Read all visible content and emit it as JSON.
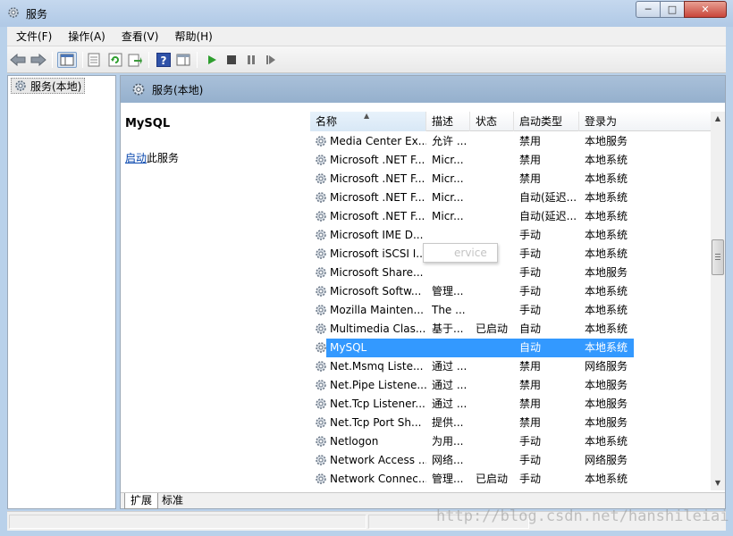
{
  "window": {
    "title": "服务",
    "min_glyph": "─",
    "max_glyph": "□",
    "close_glyph": "✕"
  },
  "menu": [
    "文件(F)",
    "操作(A)",
    "查看(V)",
    "帮助(H)"
  ],
  "toolbar": {
    "icons": [
      "back-arrow-icon",
      "forward-arrow-icon",
      "show-hide-tree-icon",
      "properties-icon",
      "refresh-icon",
      "export-list-icon",
      "help-icon",
      "show-action-pane-icon",
      "start-service-icon",
      "stop-service-icon",
      "pause-service-icon",
      "restart-service-icon"
    ]
  },
  "tree": {
    "root_label": "服务(本地)"
  },
  "pane": {
    "header_title": "服务(本地)",
    "selected_service": "MySQL",
    "action_link": "启动",
    "action_suffix": "此服务"
  },
  "columns": {
    "name": "名称",
    "description": "描述",
    "status": "状态",
    "startup": "启动类型",
    "logon": "登录为"
  },
  "services": [
    {
      "name": "Media Center Ex...",
      "desc": "允许 ...",
      "status": "",
      "startup": "禁用",
      "logon": "本地服务"
    },
    {
      "name": "Microsoft .NET F...",
      "desc": "Micr...",
      "status": "",
      "startup": "禁用",
      "logon": "本地系统"
    },
    {
      "name": "Microsoft .NET F...",
      "desc": "Micr...",
      "status": "",
      "startup": "禁用",
      "logon": "本地系统"
    },
    {
      "name": "Microsoft .NET F...",
      "desc": "Micr...",
      "status": "",
      "startup": "自动(延迟...",
      "logon": "本地系统"
    },
    {
      "name": "Microsoft .NET F...",
      "desc": "Micr...",
      "status": "",
      "startup": "自动(延迟...",
      "logon": "本地系统"
    },
    {
      "name": "Microsoft IME D...",
      "desc": "",
      "status": "",
      "startup": "手动",
      "logon": "本地系统"
    },
    {
      "name": "Microsoft iSCSI I...",
      "desc": "管理...",
      "status": "",
      "startup": "手动",
      "logon": "本地系统"
    },
    {
      "name": "Microsoft Share...",
      "desc": "",
      "status": "",
      "startup": "手动",
      "logon": "本地服务"
    },
    {
      "name": "Microsoft Softw...",
      "desc": "管理...",
      "status": "",
      "startup": "手动",
      "logon": "本地系统"
    },
    {
      "name": "Mozilla Mainten...",
      "desc": "The ...",
      "status": "",
      "startup": "手动",
      "logon": "本地系统"
    },
    {
      "name": "Multimedia Clas...",
      "desc": "基于...",
      "status": "已启动",
      "startup": "自动",
      "logon": "本地系统"
    },
    {
      "name": "MySQL",
      "desc": "",
      "status": "",
      "startup": "自动",
      "logon": "本地系统",
      "selected": true
    },
    {
      "name": "Net.Msmq Liste...",
      "desc": "通过 ...",
      "status": "",
      "startup": "禁用",
      "logon": "网络服务"
    },
    {
      "name": "Net.Pipe Listene...",
      "desc": "通过 ...",
      "status": "",
      "startup": "禁用",
      "logon": "本地服务"
    },
    {
      "name": "Net.Tcp Listener...",
      "desc": "通过 ...",
      "status": "",
      "startup": "禁用",
      "logon": "本地服务"
    },
    {
      "name": "Net.Tcp Port Sh...",
      "desc": "提供...",
      "status": "",
      "startup": "禁用",
      "logon": "本地服务"
    },
    {
      "name": "Netlogon",
      "desc": "为用...",
      "status": "",
      "startup": "手动",
      "logon": "本地系统"
    },
    {
      "name": "Network Access ...",
      "desc": "网络...",
      "status": "",
      "startup": "手动",
      "logon": "网络服务"
    },
    {
      "name": "Network Connec...",
      "desc": "管理...",
      "status": "已启动",
      "startup": "手动",
      "logon": "本地系统"
    }
  ],
  "tooltip": "ervice",
  "tabs": {
    "extended": "扩展",
    "standard": "标准"
  },
  "scrollbar": {
    "position": 0.36
  },
  "watermark": "http://blog.csdn.net/hanshileiai",
  "colors": {
    "selection": "#3399ff",
    "header_band": "#a9c0d9",
    "link": "#0645ad",
    "play_green": "#2e9e2e"
  }
}
